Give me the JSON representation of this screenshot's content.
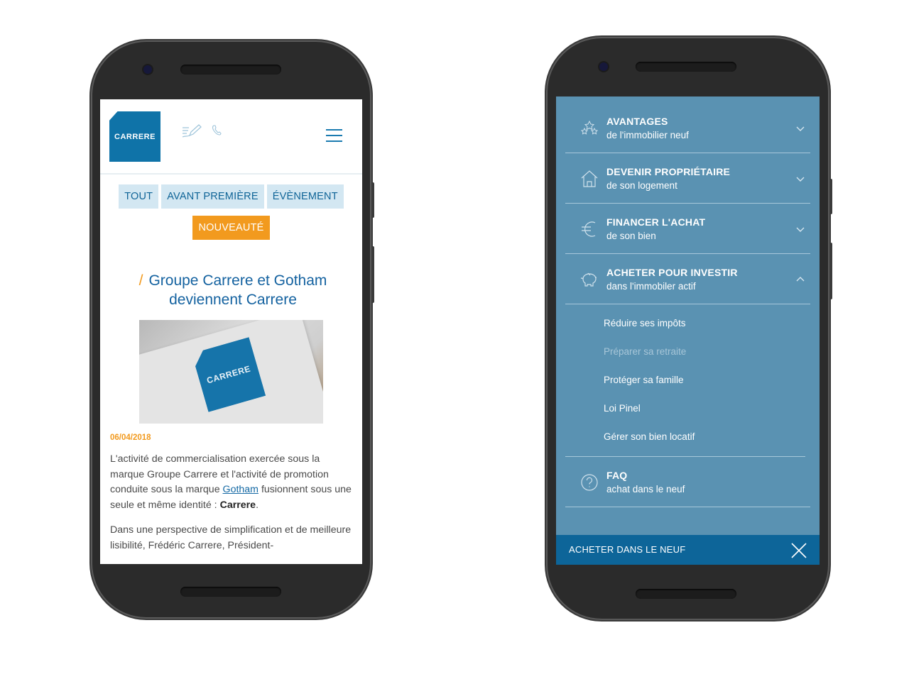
{
  "left_phone": {
    "header": {
      "logo_text": "CARRERE",
      "icons": [
        "pencil-icon",
        "phone-icon",
        "menu-icon"
      ]
    },
    "filters": [
      {
        "label": "TOUT",
        "active": false
      },
      {
        "label": "AVANT PREMIÈRE",
        "active": false
      },
      {
        "label": "ÉVÈNEMENT",
        "active": false
      },
      {
        "label": "NOUVEAUTÉ",
        "active": true
      }
    ],
    "article": {
      "slash": "/",
      "title": "Groupe Carrere et Gotham deviennent Carrere",
      "image_logo_text": "CARRERE",
      "date": "06/04/2018",
      "p1_a": "L'activité de commercialisation exercée sous la marque Groupe Carrere et l'activité de promotion conduite sous la marque ",
      "p1_link": "Gotham",
      "p1_b": " fusionnent sous une seule et même identité : ",
      "p1_bold": "Carrere",
      "p1_end": ".",
      "p2": "Dans une perspective de simplification et de meilleure lisibilité, Frédéric Carrere, Président-"
    },
    "colors": {
      "brand": "#0f73a8",
      "accent": "#f29a1e",
      "chip_bg": "#d3e7f2"
    }
  },
  "right_phone": {
    "menu": [
      {
        "title": "AVANTAGES",
        "subtitle": "de l'immobilier neuf",
        "icon": "stars-icon",
        "expanded": false
      },
      {
        "title": "DEVENIR PROPRIÉTAIRE",
        "subtitle": "de son logement",
        "icon": "house-icon",
        "expanded": false
      },
      {
        "title": "FINANCER L'ACHAT",
        "subtitle": "de son bien",
        "icon": "euro-icon",
        "expanded": false
      },
      {
        "title": "ACHETER POUR INVESTIR",
        "subtitle": "dans l'immobiler actif",
        "icon": "piggy-bank-icon",
        "expanded": true
      },
      {
        "title": "FAQ",
        "subtitle": "achat dans le neuf",
        "icon": "question-icon",
        "expanded": false
      }
    ],
    "submenu": [
      {
        "label": "Réduire ses impôts",
        "muted": false
      },
      {
        "label": "Préparer sa retraite",
        "muted": true
      },
      {
        "label": "Protéger sa famille",
        "muted": false
      },
      {
        "label": "Loi Pinel",
        "muted": false
      },
      {
        "label": "Gérer son bien locatif",
        "muted": false
      }
    ],
    "bottom_bar": {
      "label": "ACHETER DANS LE NEUF",
      "icon": "close-icon"
    },
    "colors": {
      "panel": "#5a92b2",
      "bar": "#0d6599"
    }
  }
}
